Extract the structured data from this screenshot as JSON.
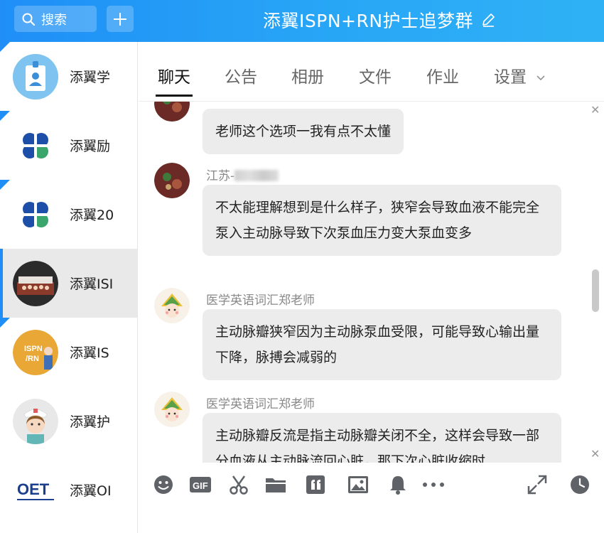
{
  "header": {
    "search_label": "搜索",
    "title": "添翼ISPN+RN护士追梦群"
  },
  "sidebar": {
    "items": [
      {
        "label": "添翼学",
        "avatar": "id-badge-icon",
        "unread": true
      },
      {
        "label": "添翼励",
        "avatar": "blue-clover-logo",
        "unread": true
      },
      {
        "label": "添翼20",
        "avatar": "blue-clover-logo",
        "unread": true
      },
      {
        "label": "添翼ISI",
        "avatar": "group-photo",
        "unread": false,
        "active": true
      },
      {
        "label": "添翼IS",
        "avatar": "ispn-rn-logo",
        "unread": true
      },
      {
        "label": "添翼护",
        "avatar": "nurse-cartoon",
        "unread": false
      },
      {
        "label": "添翼OI",
        "avatar": "oet-logo",
        "unread": false
      }
    ]
  },
  "tabs": [
    "聊天",
    "公告",
    "相册",
    "文件",
    "作业",
    "设置"
  ],
  "messages": [
    {
      "sender": "",
      "text": "老师这个选项一我有点不太懂"
    },
    {
      "sender": "江苏-",
      "sender_blurred": true,
      "text": "不太能理解想到是什么样子，狭窄会导致血液不能完全泵入主动脉导致下次泵血压力变大泵血变多"
    },
    {
      "sender": "医学英语词汇郑老师",
      "text": "主动脉瓣狭窄因为主动脉泵血受限，可能导致心输出量下降，脉搏会减弱的"
    },
    {
      "sender": "医学英语词汇郑老师",
      "text": "主动脉瓣反流是指主动脉瓣关闭不全，这样会导致一部分血液从主动脉流回心脏，那下次心脏收缩时"
    }
  ],
  "toolbar": [
    "emoji-icon",
    "gif-icon",
    "scissors-icon",
    "folder-icon",
    "quote-icon",
    "image-icon",
    "bell-icon",
    "more-icon",
    "expand-icon",
    "clock-icon"
  ],
  "colors": {
    "accent": "#1f8ff7",
    "bubble": "#ececec"
  }
}
